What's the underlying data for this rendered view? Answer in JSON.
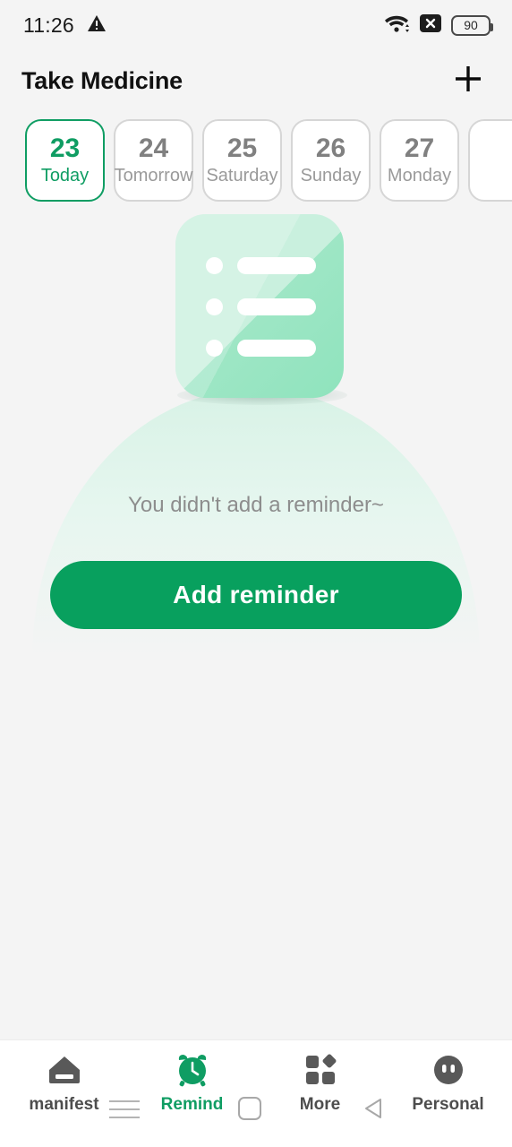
{
  "status_bar": {
    "time": "11:26",
    "warning_icon": "warning-triangle-icon",
    "wifi_icon": "wifi-icon",
    "signal_x_icon": "signal-x-icon",
    "battery_level": "90"
  },
  "app_bar": {
    "title": "Take Medicine",
    "add_icon": "plus-icon"
  },
  "date_strip": {
    "chips": [
      {
        "day": "23",
        "label": "Today",
        "selected": true
      },
      {
        "day": "24",
        "label": "Tomorrow",
        "selected": false
      },
      {
        "day": "25",
        "label": "Saturday",
        "selected": false
      },
      {
        "day": "26",
        "label": "Sunday",
        "selected": false
      },
      {
        "day": "27",
        "label": "Monday",
        "selected": false
      },
      {
        "day": "",
        "label": "",
        "selected": false
      }
    ]
  },
  "empty_state": {
    "illustration_icon": "checklist-note-illustration",
    "message": "You didn't add a reminder~",
    "button_label": "Add reminder"
  },
  "bottom_nav": {
    "items": [
      {
        "label": "manifest",
        "icon": "home-icon",
        "active": false
      },
      {
        "label": "Remind",
        "icon": "alarm-clock-icon",
        "active": true
      },
      {
        "label": "More",
        "icon": "grid-icon",
        "active": false
      },
      {
        "label": "Personal",
        "icon": "face-avatar-icon",
        "active": false
      }
    ]
  },
  "system_nav": {
    "recents_icon": "recents-menu-icon",
    "home_icon": "home-square-icon",
    "back_icon": "back-triangle-icon"
  },
  "colors": {
    "accent_green": "#0f9d63",
    "button_green": "#08a05e",
    "page_background": "#f4f4f4",
    "muted_text": "#8d8d8d"
  }
}
